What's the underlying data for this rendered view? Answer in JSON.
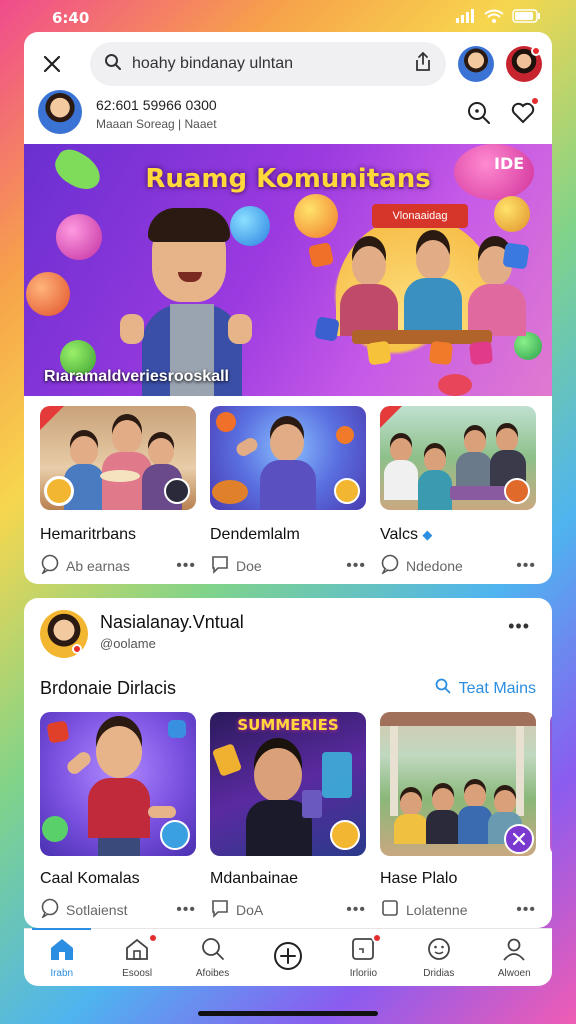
{
  "status": {
    "time": "6:40"
  },
  "search": {
    "query": "hoahy bindanay ulntan"
  },
  "profile": {
    "line1": "62:601  59966   0300",
    "line2": "Maaan Soreag  |  Naaet"
  },
  "banner": {
    "title": "Ruamg Komunitans",
    "sign": "Vlonaaidag",
    "caption": "Rıaramaldveriesrooskall",
    "corner": "IDE"
  },
  "tiles_top": [
    {
      "title": "Hemaritrbans",
      "meta": "Ab earnas"
    },
    {
      "title": "Dendemlalm",
      "meta": "Doe"
    },
    {
      "title": "Valcs",
      "meta": "Ndedone"
    }
  ],
  "post": {
    "name": "Nasialanay.Vntual",
    "handle": "@oolame"
  },
  "section": {
    "title": "Brdonaie Dirlacis",
    "link": "Teat Mains"
  },
  "tiles_bottom": [
    {
      "title": "Caal Komalas",
      "meta": "Sotlaienst"
    },
    {
      "title": "Mdanbainae",
      "meta": "DoA"
    },
    {
      "title": "Hase Plalo",
      "meta": "Lolatenne"
    }
  ],
  "tile_art_text": {
    "poster": "SUMMERIES"
  },
  "nav": [
    {
      "label": "Irabn",
      "icon": "home-icon"
    },
    {
      "label": "Esoosl",
      "icon": "house-outline-icon"
    },
    {
      "label": "Afoibes",
      "icon": "search-icon"
    },
    {
      "label": "",
      "icon": "plus-circle-icon"
    },
    {
      "label": "Irloriio",
      "icon": "inbox-icon"
    },
    {
      "label": "Dridias",
      "icon": "emoji-icon"
    },
    {
      "label": "Alwoen",
      "icon": "person-icon"
    }
  ],
  "colors": {
    "accent": "#2b8ee0",
    "notification": "#e52d2d",
    "banner_title": "#ffd93a"
  }
}
